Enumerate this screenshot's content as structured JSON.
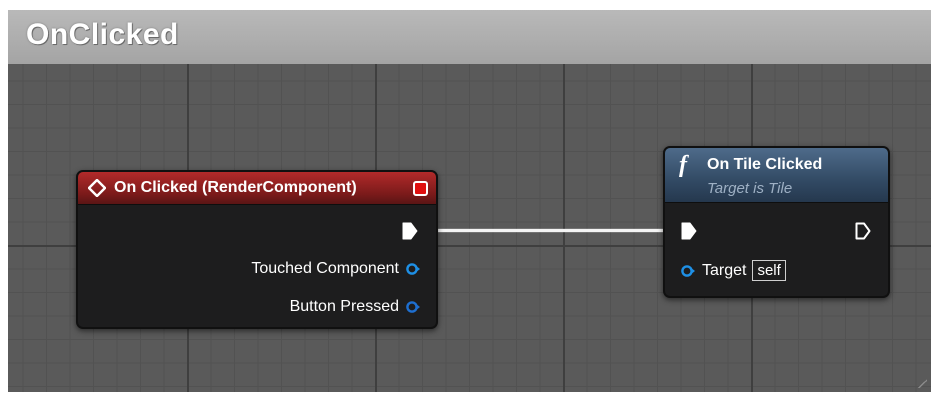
{
  "graph": {
    "title": "OnClicked"
  },
  "event_node": {
    "title": "On Clicked (RenderComponent)",
    "pins": [
      {
        "label": "Touched Component"
      },
      {
        "label": "Button Pressed"
      }
    ]
  },
  "function_node": {
    "icon_glyph": "f",
    "title": "On Tile Clicked",
    "subtitle": "Target is Tile",
    "target_label": "Target",
    "target_default": "self"
  },
  "colors": {
    "event_header": "#9b2020",
    "function_header": "#3e5a78",
    "object_pin": "#1e90e6",
    "exec_wire": "#f4f4f4",
    "delegate_pin": "#e01010"
  },
  "icons": {
    "event": "event-diamond-icon",
    "function": "function-f-icon",
    "exec_out_filled": "exec-pin-filled-icon",
    "exec_out_empty": "exec-pin-empty-icon",
    "object_pin": "object-pin-icon",
    "delegate": "delegate-pin-icon"
  }
}
